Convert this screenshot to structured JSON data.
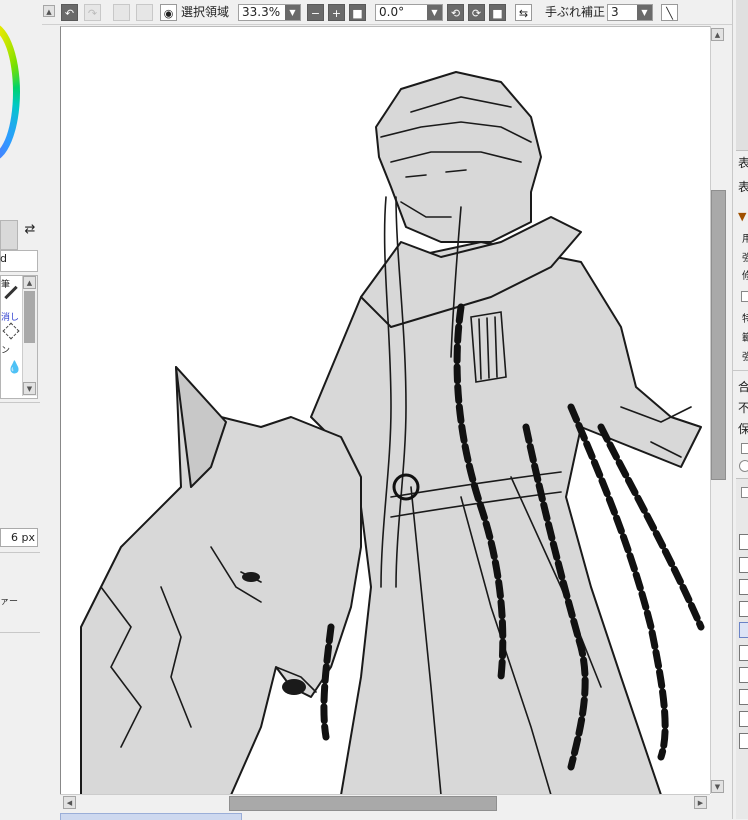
{
  "toolbar": {
    "selection_label": "選択領域",
    "zoom_value": "33.3%",
    "rotation_value": "0.0°",
    "stabilizer_label": "手ぶれ補正",
    "stabilizer_value": "3"
  },
  "left_panel": {
    "brush_size": "6 px",
    "tool_text_1": "筆",
    "tool_text_2": "消し",
    "tool_text_3": "ン",
    "misc_text": "ァー",
    "small_label": "d"
  },
  "right_panel": {
    "texts": [
      "表",
      "表",
      "▼ 特",
      "用",
      "強",
      "修",
      "特",
      "範",
      "強",
      "合",
      "不",
      "保"
    ]
  },
  "icons": {
    "undo": "undo-icon",
    "redo": "redo-icon",
    "eye": "eye-icon",
    "zoom_out": "minus-icon",
    "zoom_in": "plus-icon",
    "fit": "square-icon",
    "rotate_ccw": "rotate-ccw-icon",
    "rotate_cw": "rotate-cw-icon",
    "flip": "flip-icon",
    "pen": "line-tool-icon"
  }
}
